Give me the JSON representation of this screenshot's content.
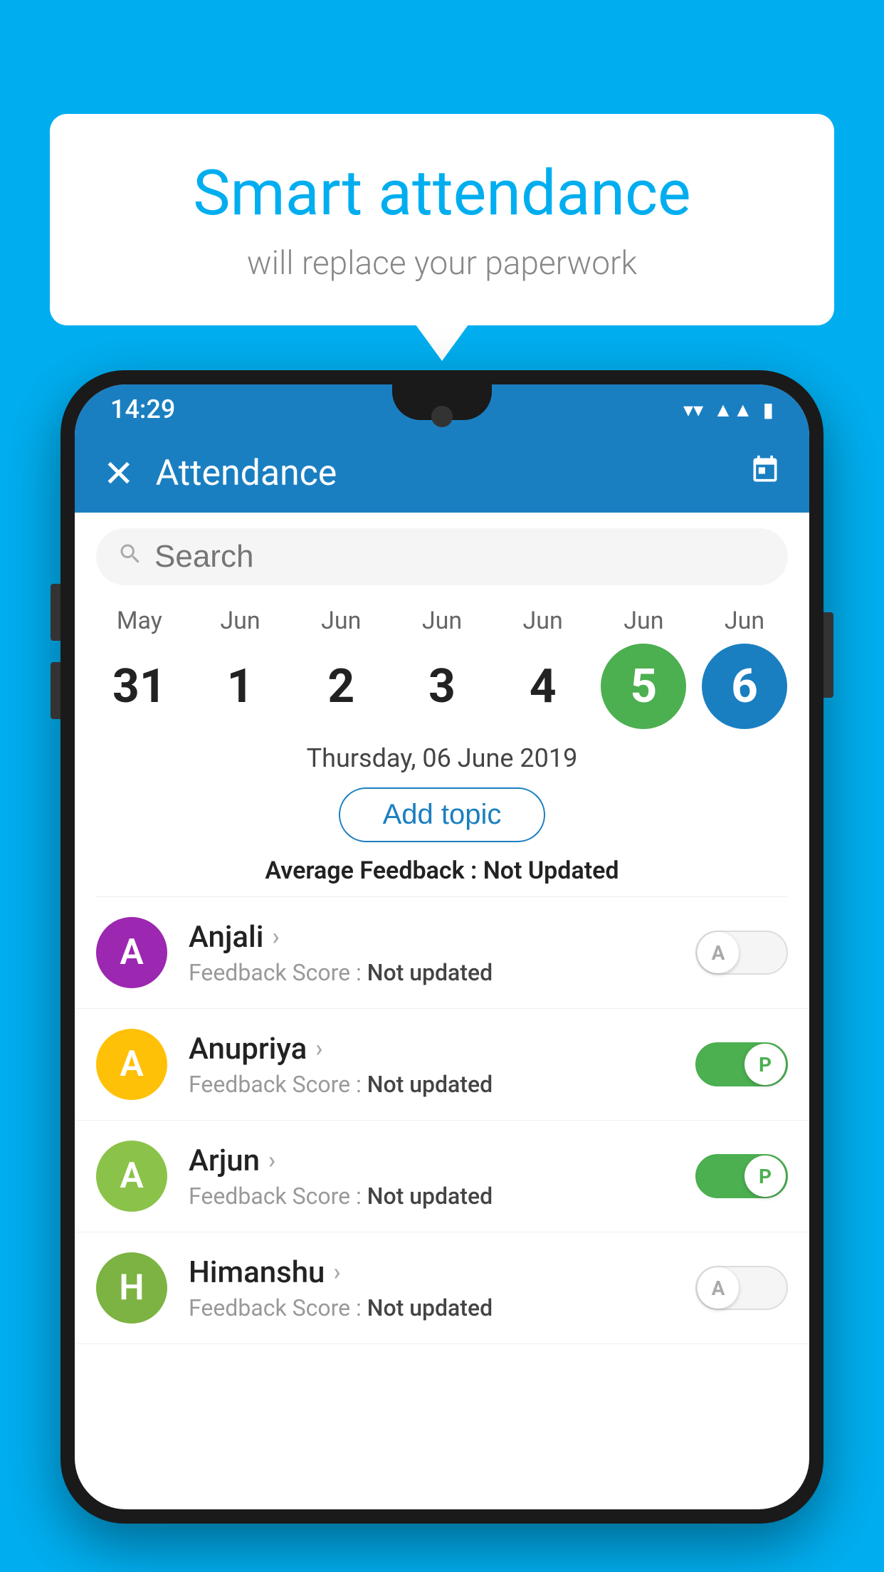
{
  "background_color": "#00AEEF",
  "speech_bubble": {
    "title": "Smart attendance",
    "subtitle": "will replace your paperwork"
  },
  "status_bar": {
    "time": "14:29",
    "icons": [
      "wifi",
      "signal",
      "battery"
    ]
  },
  "app_bar": {
    "close_label": "✕",
    "title": "Attendance",
    "calendar_icon": "📅"
  },
  "search": {
    "placeholder": "Search"
  },
  "calendar": {
    "days": [
      {
        "month": "May",
        "date": "31",
        "type": "normal"
      },
      {
        "month": "Jun",
        "date": "1",
        "type": "normal"
      },
      {
        "month": "Jun",
        "date": "2",
        "type": "normal"
      },
      {
        "month": "Jun",
        "date": "3",
        "type": "normal"
      },
      {
        "month": "Jun",
        "date": "4",
        "type": "normal"
      },
      {
        "month": "Jun",
        "date": "5",
        "type": "today"
      },
      {
        "month": "Jun",
        "date": "6",
        "type": "selected"
      }
    ]
  },
  "selected_date_label": "Thursday, 06 June 2019",
  "add_topic_label": "Add topic",
  "average_feedback_label": "Average Feedback :",
  "average_feedback_value": "Not Updated",
  "students": [
    {
      "name": "Anjali",
      "avatar_letter": "A",
      "avatar_class": "avatar-purple",
      "feedback_label": "Feedback Score :",
      "feedback_value": "Not updated",
      "toggle_state": "off",
      "toggle_letter": "A"
    },
    {
      "name": "Anupriya",
      "avatar_letter": "A",
      "avatar_class": "avatar-yellow",
      "feedback_label": "Feedback Score :",
      "feedback_value": "Not updated",
      "toggle_state": "on",
      "toggle_letter": "P"
    },
    {
      "name": "Arjun",
      "avatar_letter": "A",
      "avatar_class": "avatar-green",
      "feedback_label": "Feedback Score :",
      "feedback_value": "Not updated",
      "toggle_state": "on",
      "toggle_letter": "P"
    },
    {
      "name": "Himanshu",
      "avatar_letter": "H",
      "avatar_class": "avatar-green-dark",
      "feedback_label": "Feedback Score :",
      "feedback_value": "Not updated",
      "toggle_state": "off",
      "toggle_letter": "A"
    }
  ]
}
